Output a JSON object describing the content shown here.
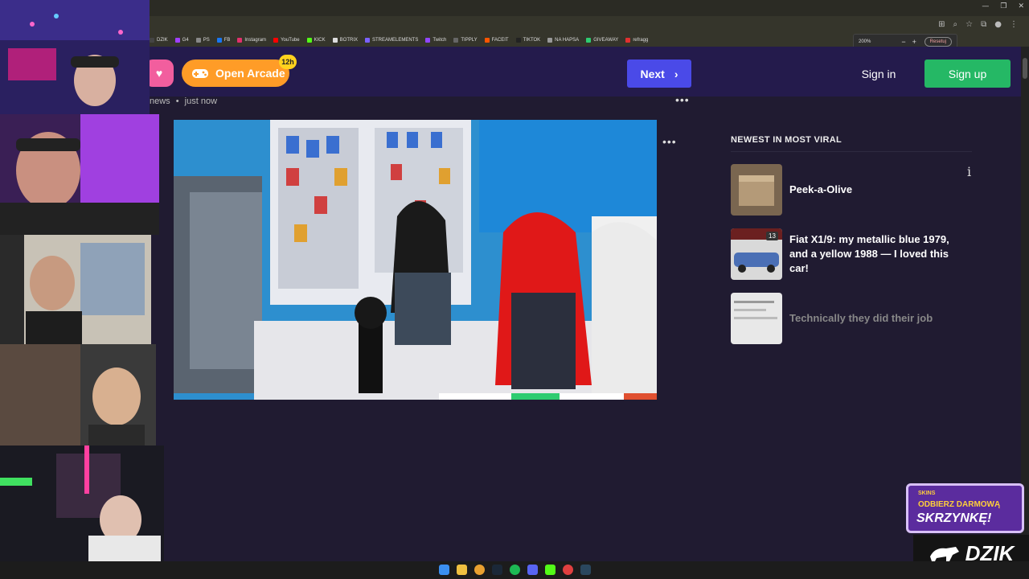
{
  "browser": {
    "bookmarks": [
      {
        "label": "DZIK",
        "color": "#444"
      },
      {
        "label": "G4",
        "color": "#a040ff"
      },
      {
        "label": "PS",
        "color": "#888"
      },
      {
        "label": "FB",
        "color": "#1877f2"
      },
      {
        "label": "Instagram",
        "color": "#e1306c"
      },
      {
        "label": "YouTube",
        "color": "#ff0000"
      },
      {
        "label": "KICK",
        "color": "#53fc18"
      },
      {
        "label": "BOTRIX",
        "color": "#dddddd"
      },
      {
        "label": "STREAMELEMENTS",
        "color": "#7b61ff"
      },
      {
        "label": "Twitch",
        "color": "#9146ff"
      },
      {
        "label": "TIPPLY",
        "color": "#666"
      },
      {
        "label": "FACEIT",
        "color": "#ff5500"
      },
      {
        "label": "TIKTOK",
        "color": "#222"
      },
      {
        "label": "NA HAPSA",
        "color": "#999"
      },
      {
        "label": "GIVEAWAY",
        "color": "#2ecc71"
      },
      {
        "label": "refragg",
        "color": "#e03030"
      }
    ],
    "zoom": {
      "level": "200%",
      "minus": "−",
      "plus": "+",
      "reset": "Resetuj"
    },
    "window_controls": [
      "—",
      "❐",
      "✕"
    ]
  },
  "header": {
    "arcade_label": "Open Arcade",
    "arcade_badge": "12h",
    "next_label": "Next",
    "signin_label": "Sign in",
    "signup_label": "Sign up"
  },
  "post": {
    "source": "news",
    "separator": "•",
    "time": "just now",
    "more": "•••"
  },
  "sidebar": {
    "title": "NEWEST IN MOST VIRAL",
    "info": "i",
    "items": [
      {
        "title": "Peek-a-Olive",
        "dim": false
      },
      {
        "title": "Fiat X1/9: my metallic blue 1979, and a yellow 1988 — I loved this car!",
        "badge": "13",
        "dim": false
      },
      {
        "title": "Technically they did their job",
        "dim": true
      }
    ]
  },
  "promo": {
    "brand": "SKINS",
    "line1": "ODBIERZ DARMOWĄ",
    "line2": "SKRZYNKĘ!"
  },
  "dzik_logo": "DZIK",
  "colors": {
    "site_bg": "#201b31",
    "header_bg": "#241b4c",
    "arcade": "#ff9c27",
    "next": "#4a4ae8",
    "signup": "#25b865"
  }
}
